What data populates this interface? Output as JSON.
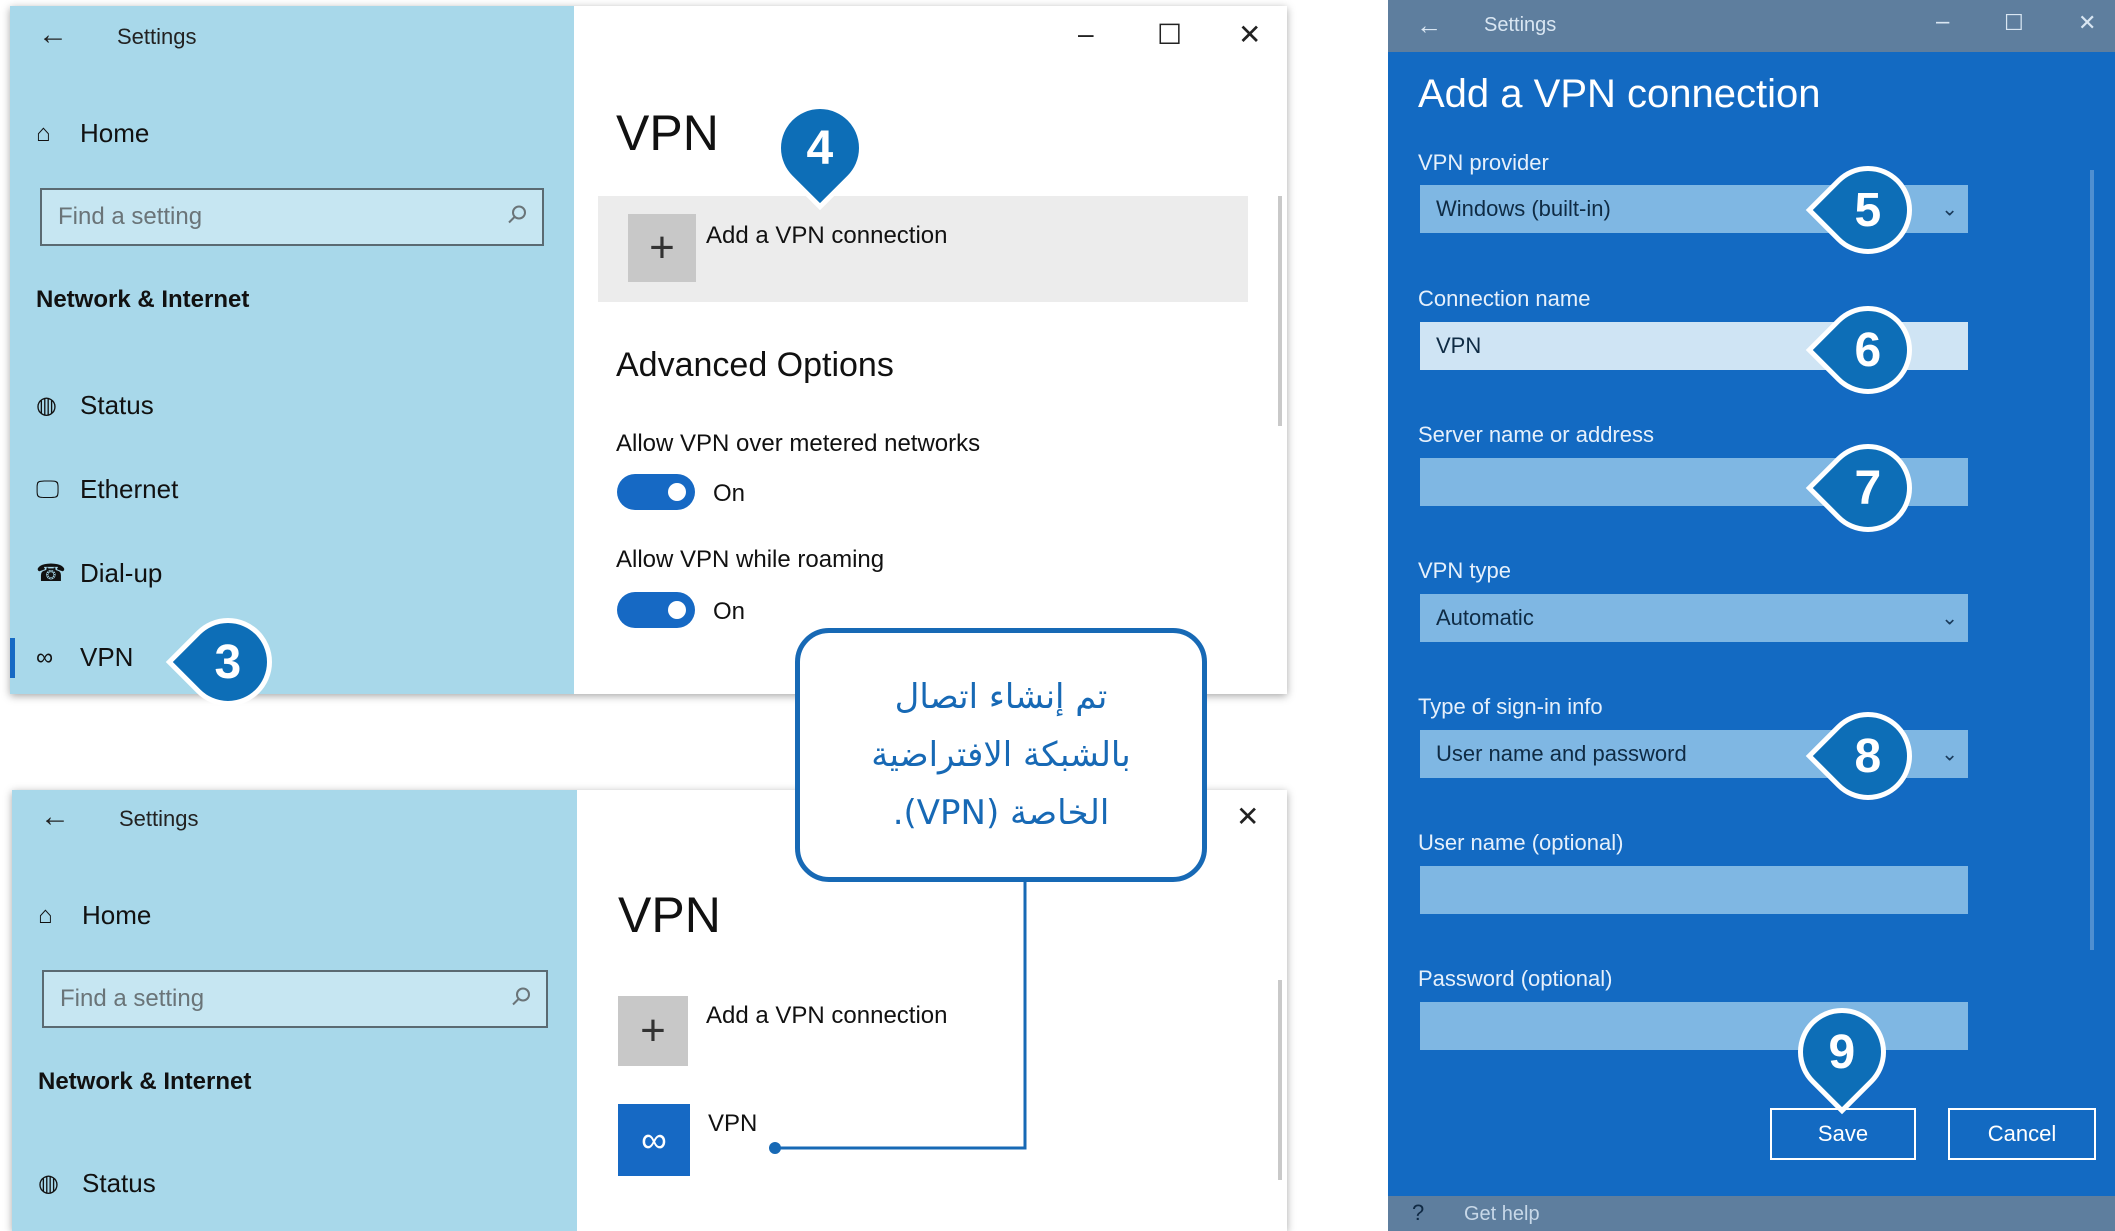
{
  "window1": {
    "title": "Settings",
    "home": "Home",
    "search_placeholder": "Find a setting",
    "section": "Network & Internet",
    "nav": [
      {
        "label": "Status",
        "icon": "globe-icon"
      },
      {
        "label": "Ethernet",
        "icon": "ethernet-icon"
      },
      {
        "label": "Dial-up",
        "icon": "dialup-icon"
      },
      {
        "label": "VPN",
        "icon": "vpn-icon"
      }
    ],
    "pane_title": "VPN",
    "add_vpn": "Add a VPN connection",
    "advanced": "Advanced Options",
    "option1": "Allow VPN over metered networks",
    "option1_state": "On",
    "option2": "Allow VPN while roaming",
    "option2_state": "On"
  },
  "window2": {
    "title": "Settings",
    "home": "Home",
    "search_placeholder": "Find a setting",
    "section": "Network & Internet",
    "nav_status": "Status",
    "pane_title": "VPN",
    "add_vpn": "Add a VPN connection",
    "vpn_entry": "VPN"
  },
  "dialog": {
    "titlebar": "Settings",
    "title": "Add a VPN connection",
    "provider_label": "VPN provider",
    "provider_value": "Windows (built-in)",
    "conn_label": "Connection name",
    "conn_value": "VPN",
    "server_label": "Server name or address",
    "type_label": "VPN type",
    "type_value": "Automatic",
    "signin_label": "Type of sign-in info",
    "signin_value": "User name and password",
    "user_label": "User name (optional)",
    "pass_label": "Password (optional)",
    "save": "Save",
    "cancel": "Cancel",
    "help": "Get help"
  },
  "badges": {
    "b3": "3",
    "b4": "4",
    "b5": "5",
    "b6": "6",
    "b7": "7",
    "b8": "8",
    "b9": "9"
  },
  "callout": "تم إنشاء اتصال\nبالشبكة الافتراضية\nالخاصة (VPN)."
}
